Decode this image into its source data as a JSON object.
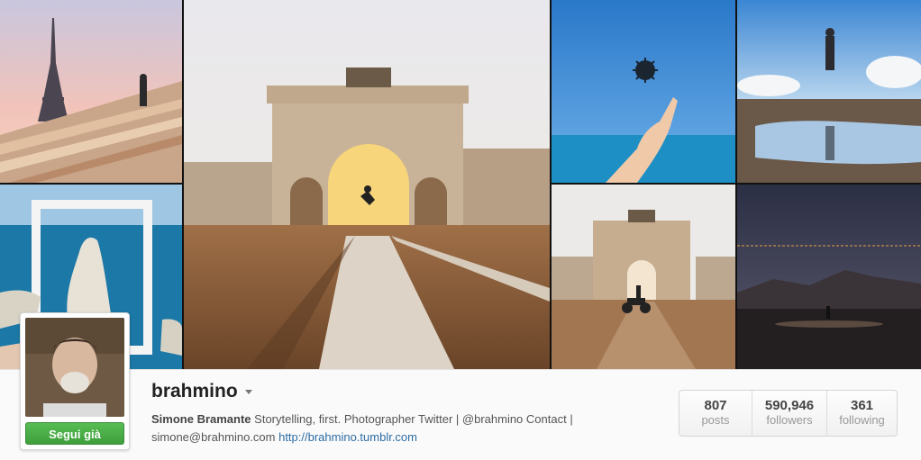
{
  "profile": {
    "username": "brahmino",
    "follow_label": "Segui già",
    "full_name": "Simone Bramante",
    "bio_text": " Storytelling, first. Photographer Twitter | @brahmino Contact | simone@brahmino.com ",
    "website": "http://brahmino.tumblr.com"
  },
  "stats": [
    {
      "count": "807",
      "label": "posts"
    },
    {
      "count": "590,946",
      "label": "followers"
    },
    {
      "count": "361",
      "label": "following"
    }
  ],
  "colors": {
    "follow_button": "#4caf47",
    "link": "#2e6da4",
    "background": "#fafafa"
  }
}
